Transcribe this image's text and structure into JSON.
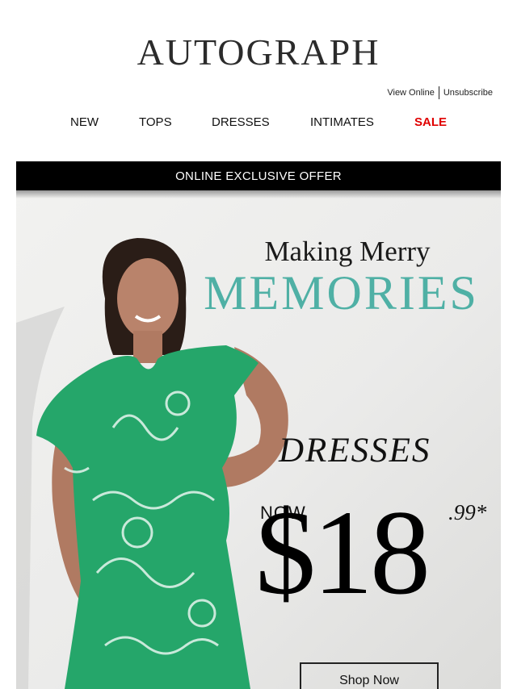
{
  "header": {
    "logo": "AUTOGRAPH",
    "view_online": "View Online",
    "unsubscribe": "Unsubscribe"
  },
  "nav": {
    "items": [
      {
        "label": "NEW"
      },
      {
        "label": "TOPS"
      },
      {
        "label": "DRESSES"
      },
      {
        "label": "INTIMATES"
      },
      {
        "label": "SALE"
      }
    ]
  },
  "hero": {
    "banner": "ONLINE EXCLUSIVE OFFER",
    "tagline": "Making Merry",
    "headline": "MEMORIES",
    "category": "DRESSES",
    "now_label": "NOW",
    "price": "$18",
    "cents": ".99*",
    "cta": "Shop Now"
  },
  "colors": {
    "accent_teal": "#4fb0a5",
    "sale_red": "#e00000",
    "dress_green": "#25a66a"
  }
}
